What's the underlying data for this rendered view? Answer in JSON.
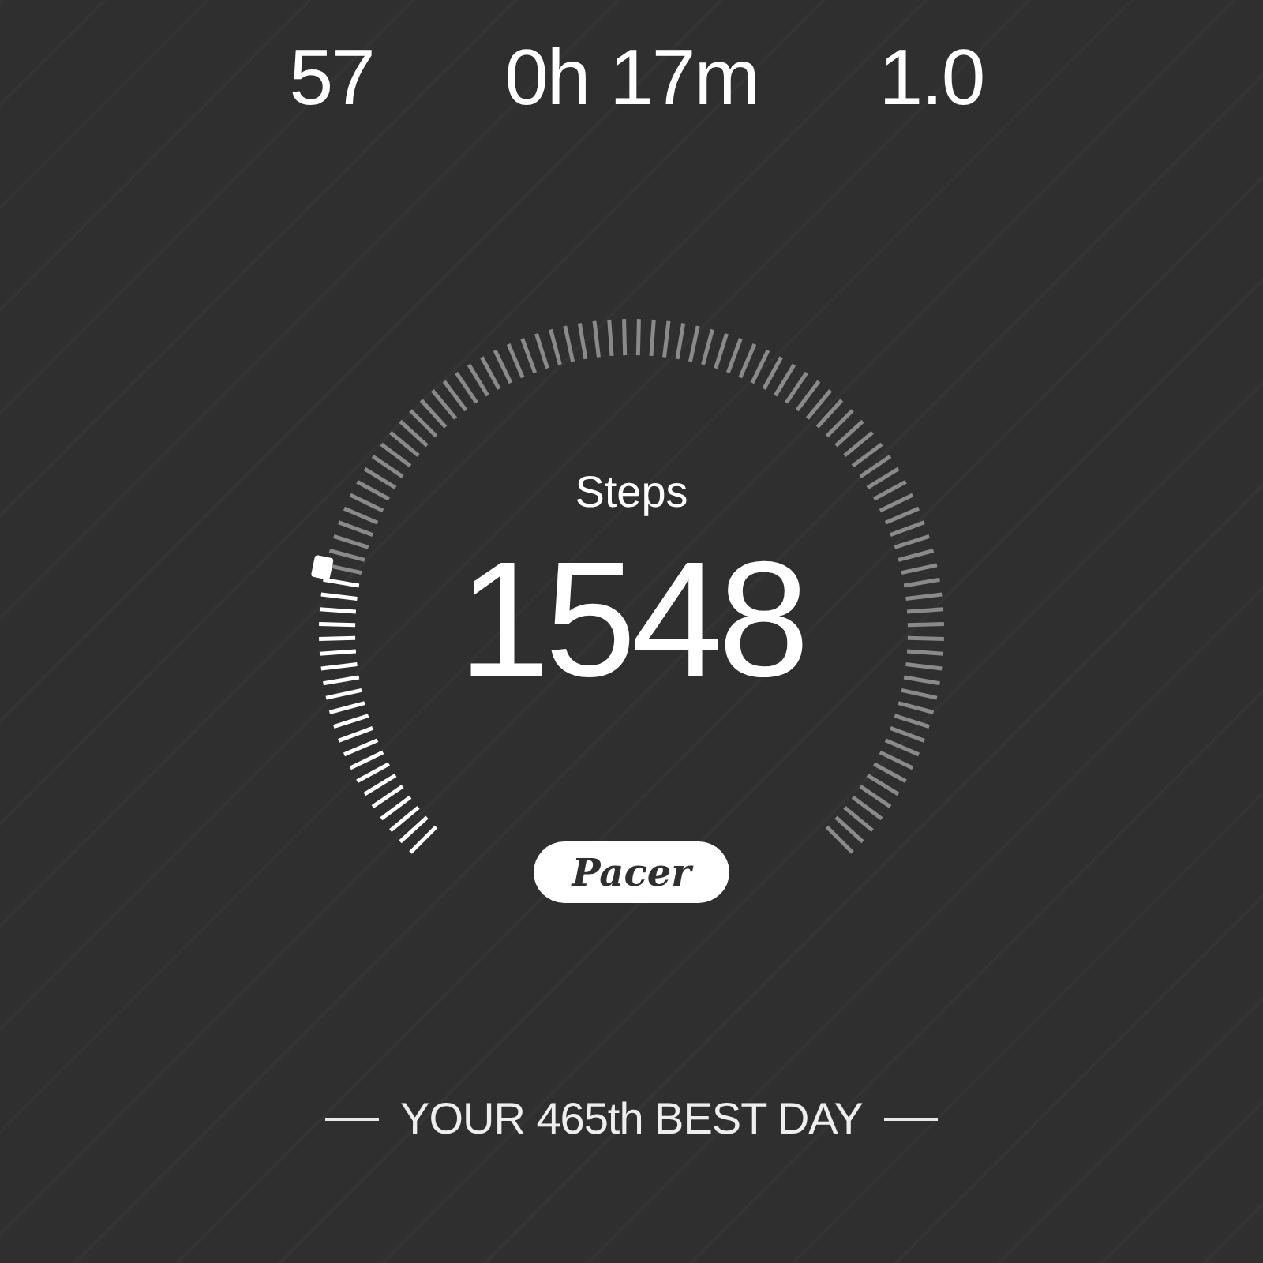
{
  "stats": [
    {
      "value": "57"
    },
    {
      "value": "0h 17m"
    },
    {
      "value": "1.0"
    }
  ],
  "gauge": {
    "label": "Steps",
    "value": "1548"
  },
  "badge": "Pacer",
  "rank": "YOUR 465th BEST DAY"
}
